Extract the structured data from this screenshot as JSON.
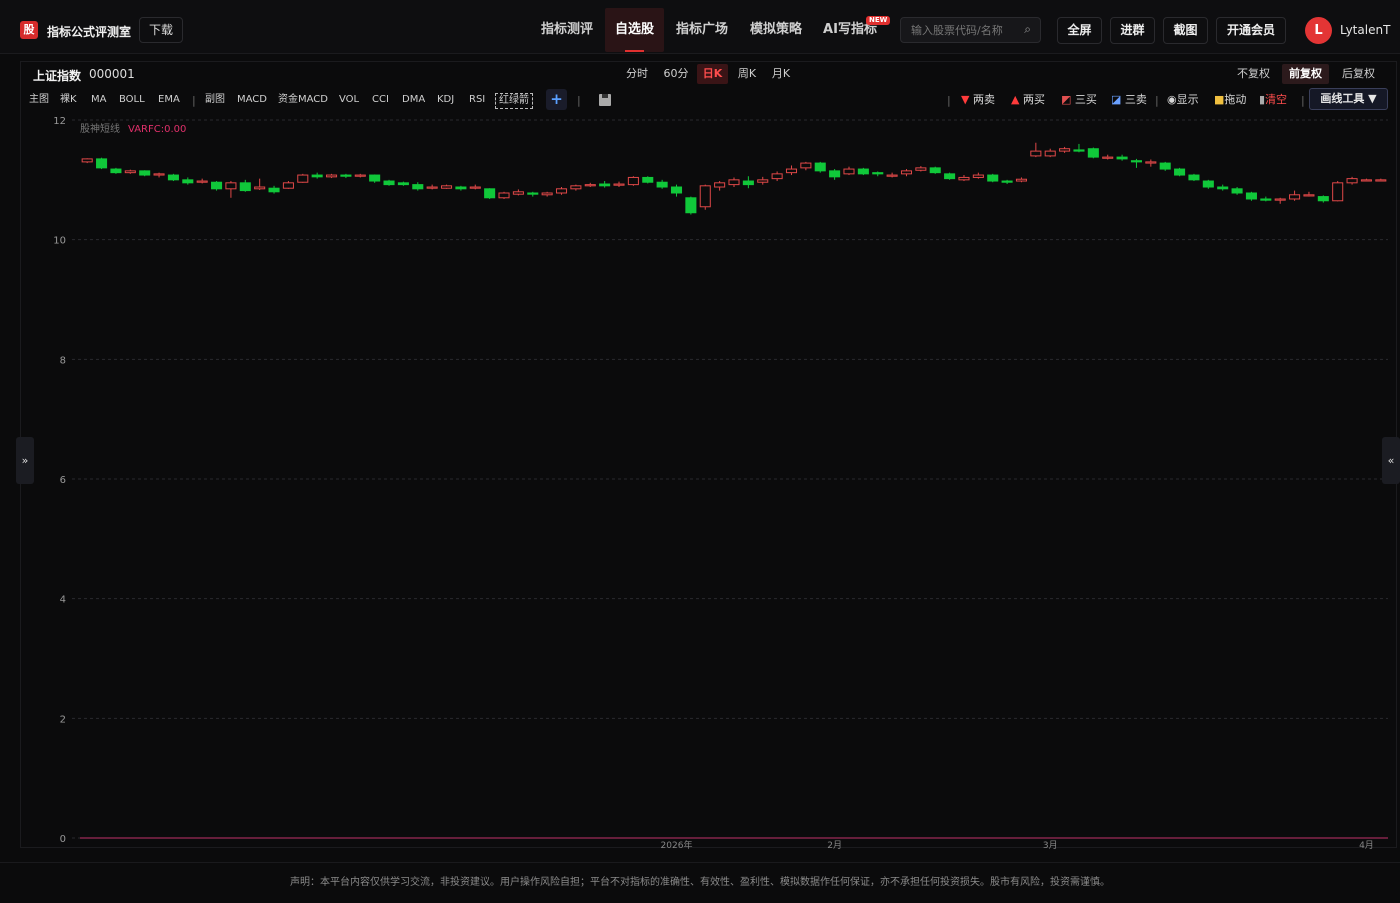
{
  "header": {
    "logo_char": "股",
    "app_title": "指标公式评测室",
    "download_label": "下载",
    "nav": [
      {
        "label": "指标测评",
        "active": false
      },
      {
        "label": "自选股",
        "active": true
      },
      {
        "label": "指标广场",
        "active": false
      },
      {
        "label": "模拟策略",
        "active": false
      },
      {
        "label": "AI写指标",
        "active": false,
        "badge": "NEW"
      }
    ],
    "search_placeholder": "输入股票代码/名称",
    "buttons": [
      "全屏",
      "进群",
      "截图",
      "开通会员"
    ],
    "user_initial": "L",
    "username": "LytalenT"
  },
  "stock": {
    "name": "上证指数",
    "code": "000001"
  },
  "periods": [
    {
      "label": "分时",
      "active": false
    },
    {
      "label": "60分",
      "active": false
    },
    {
      "label": "日K",
      "active": true
    },
    {
      "label": "周K",
      "active": false
    },
    {
      "label": "月K",
      "active": false
    }
  ],
  "adjust": [
    {
      "label": "不复权",
      "active": false
    },
    {
      "label": "前复权",
      "active": true
    },
    {
      "label": "后复权",
      "active": false
    }
  ],
  "indicators_main": [
    "主图",
    "裸K",
    "MA",
    "BOLL",
    "EMA"
  ],
  "indicators_sub": [
    "副图",
    "MACD",
    "资金MACD",
    "VOL",
    "CCI",
    "DMA",
    "KDJ",
    "RSI",
    "红绿箭"
  ],
  "tools": {
    "two_sell": "两卖",
    "two_buy": "两买",
    "three_buy": "三买",
    "three_sell": "三卖",
    "show": "显示",
    "drag": "拖动",
    "clear": "清空",
    "draw_tool": "画线工具 ▼"
  },
  "colors": {
    "up": "#e04848",
    "down": "#10c83a",
    "accent": "#e0302f",
    "grid": "#2a2a2e"
  },
  "chart_data": {
    "type": "candlestick",
    "indicator_label": "股神短线",
    "indicator_value": "VARFC:0.00",
    "y_ticks": [
      0,
      2,
      4,
      6,
      8,
      10,
      12
    ],
    "ylim": [
      0,
      12
    ],
    "x_labels": [
      {
        "label": "2026年",
        "index": 41
      },
      {
        "label": "2月",
        "index": 52
      },
      {
        "label": "3月",
        "index": 67
      },
      {
        "label": "4月",
        "index": 89
      }
    ],
    "candles": [
      [
        11.3,
        11.35,
        11.36,
        11.28
      ],
      [
        11.35,
        11.2,
        11.37,
        11.18
      ],
      [
        11.18,
        11.12,
        11.2,
        11.1
      ],
      [
        11.12,
        11.15,
        11.17,
        11.1
      ],
      [
        11.15,
        11.08,
        11.16,
        11.06
      ],
      [
        11.08,
        11.1,
        11.12,
        11.04
      ],
      [
        11.08,
        11.0,
        11.1,
        10.98
      ],
      [
        11.0,
        10.95,
        11.04,
        10.92
      ],
      [
        10.96,
        10.98,
        11.02,
        10.94
      ],
      [
        10.96,
        10.85,
        10.98,
        10.82
      ],
      [
        10.85,
        10.95,
        10.98,
        10.7
      ],
      [
        10.95,
        10.82,
        11.0,
        10.8
      ],
      [
        10.85,
        10.88,
        11.02,
        10.83
      ],
      [
        10.86,
        10.8,
        10.9,
        10.77
      ],
      [
        10.86,
        10.95,
        10.98,
        10.85
      ],
      [
        10.96,
        11.08,
        11.1,
        10.95
      ],
      [
        11.08,
        11.05,
        11.12,
        11.02
      ],
      [
        11.05,
        11.08,
        11.1,
        11.03
      ],
      [
        11.08,
        11.06,
        11.1,
        11.03
      ],
      [
        11.06,
        11.08,
        11.1,
        11.04
      ],
      [
        11.08,
        10.98,
        11.09,
        10.95
      ],
      [
        10.98,
        10.92,
        11.0,
        10.9
      ],
      [
        10.95,
        10.92,
        10.97,
        10.9
      ],
      [
        10.92,
        10.85,
        10.96,
        10.82
      ],
      [
        10.86,
        10.88,
        10.92,
        10.84
      ],
      [
        10.86,
        10.9,
        10.92,
        10.85
      ],
      [
        10.88,
        10.85,
        10.9,
        10.82
      ],
      [
        10.86,
        10.88,
        10.92,
        10.84
      ],
      [
        10.85,
        10.7,
        10.86,
        10.68
      ],
      [
        10.7,
        10.78,
        10.8,
        10.68
      ],
      [
        10.76,
        10.8,
        10.84,
        10.74
      ],
      [
        10.78,
        10.76,
        10.8,
        10.72
      ],
      [
        10.75,
        10.78,
        10.8,
        10.72
      ],
      [
        10.78,
        10.85,
        10.88,
        10.75
      ],
      [
        10.85,
        10.9,
        10.92,
        10.82
      ],
      [
        10.9,
        10.92,
        10.95,
        10.88
      ],
      [
        10.93,
        10.9,
        10.98,
        10.87
      ],
      [
        10.91,
        10.93,
        10.97,
        10.88
      ],
      [
        10.92,
        11.04,
        11.06,
        10.9
      ],
      [
        11.04,
        10.96,
        11.06,
        10.94
      ],
      [
        10.96,
        10.88,
        11.0,
        10.85
      ],
      [
        10.88,
        10.78,
        10.92,
        10.72
      ],
      [
        10.7,
        10.45,
        10.72,
        10.42
      ],
      [
        10.55,
        10.9,
        10.92,
        10.5
      ],
      [
        10.88,
        10.95,
        10.98,
        10.82
      ],
      [
        10.92,
        11.0,
        11.04,
        10.88
      ],
      [
        10.98,
        10.92,
        11.06,
        10.86
      ],
      [
        10.96,
        11.0,
        11.05,
        10.92
      ],
      [
        11.02,
        11.1,
        11.14,
        10.98
      ],
      [
        11.12,
        11.18,
        11.24,
        11.08
      ],
      [
        11.2,
        11.28,
        11.3,
        11.16
      ],
      [
        11.28,
        11.15,
        11.3,
        11.12
      ],
      [
        11.15,
        11.05,
        11.18,
        11.0
      ],
      [
        11.1,
        11.18,
        11.22,
        11.08
      ],
      [
        11.18,
        11.1,
        11.2,
        11.08
      ],
      [
        11.12,
        11.1,
        11.14,
        11.06
      ],
      [
        11.06,
        11.08,
        11.12,
        11.04
      ],
      [
        11.1,
        11.15,
        11.18,
        11.06
      ],
      [
        11.16,
        11.2,
        11.23,
        11.14
      ],
      [
        11.2,
        11.12,
        11.22,
        11.1
      ],
      [
        11.1,
        11.02,
        11.12,
        11.0
      ],
      [
        11.0,
        11.04,
        11.08,
        10.98
      ],
      [
        11.04,
        11.08,
        11.12,
        11.02
      ],
      [
        11.08,
        10.98,
        11.1,
        10.96
      ],
      [
        10.98,
        10.96,
        11.0,
        10.93
      ],
      [
        10.98,
        11.01,
        11.04,
        10.96
      ],
      [
        11.4,
        11.48,
        11.62,
        11.38
      ],
      [
        11.4,
        11.48,
        11.52,
        11.38
      ],
      [
        11.48,
        11.52,
        11.55,
        11.45
      ],
      [
        11.5,
        11.48,
        11.6,
        11.46
      ],
      [
        11.52,
        11.38,
        11.54,
        11.36
      ],
      [
        11.38,
        11.38,
        11.42,
        11.34
      ],
      [
        11.38,
        11.35,
        11.42,
        11.32
      ],
      [
        11.32,
        11.3,
        11.35,
        11.2
      ],
      [
        11.28,
        11.3,
        11.34,
        11.22
      ],
      [
        11.28,
        11.18,
        11.3,
        11.15
      ],
      [
        11.18,
        11.08,
        11.2,
        11.06
      ],
      [
        11.08,
        11.0,
        11.1,
        10.98
      ],
      [
        10.98,
        10.88,
        11.0,
        10.85
      ],
      [
        10.88,
        10.85,
        10.92,
        10.82
      ],
      [
        10.85,
        10.78,
        10.88,
        10.75
      ],
      [
        10.78,
        10.68,
        10.8,
        10.65
      ],
      [
        10.68,
        10.66,
        10.72,
        10.64
      ],
      [
        10.66,
        10.68,
        10.7,
        10.6
      ],
      [
        10.68,
        10.75,
        10.82,
        10.65
      ],
      [
        10.75,
        10.75,
        10.8,
        10.72
      ],
      [
        10.72,
        10.65,
        10.74,
        10.62
      ],
      [
        10.65,
        10.95,
        10.98,
        10.64
      ],
      [
        10.95,
        11.02,
        11.05,
        10.92
      ],
      [
        11.0,
        11.0,
        11.02,
        10.98
      ],
      [
        11.0,
        11.0,
        11.02,
        10.98
      ]
    ]
  },
  "footer": "声明：本平台内容仅供学习交流，非投资建议。用户操作风险自担；平台不对指标的准确性、有效性、盈利性、模拟数据作任何保证，亦不承担任何投资损失。股市有风险，投资需谨慎。"
}
